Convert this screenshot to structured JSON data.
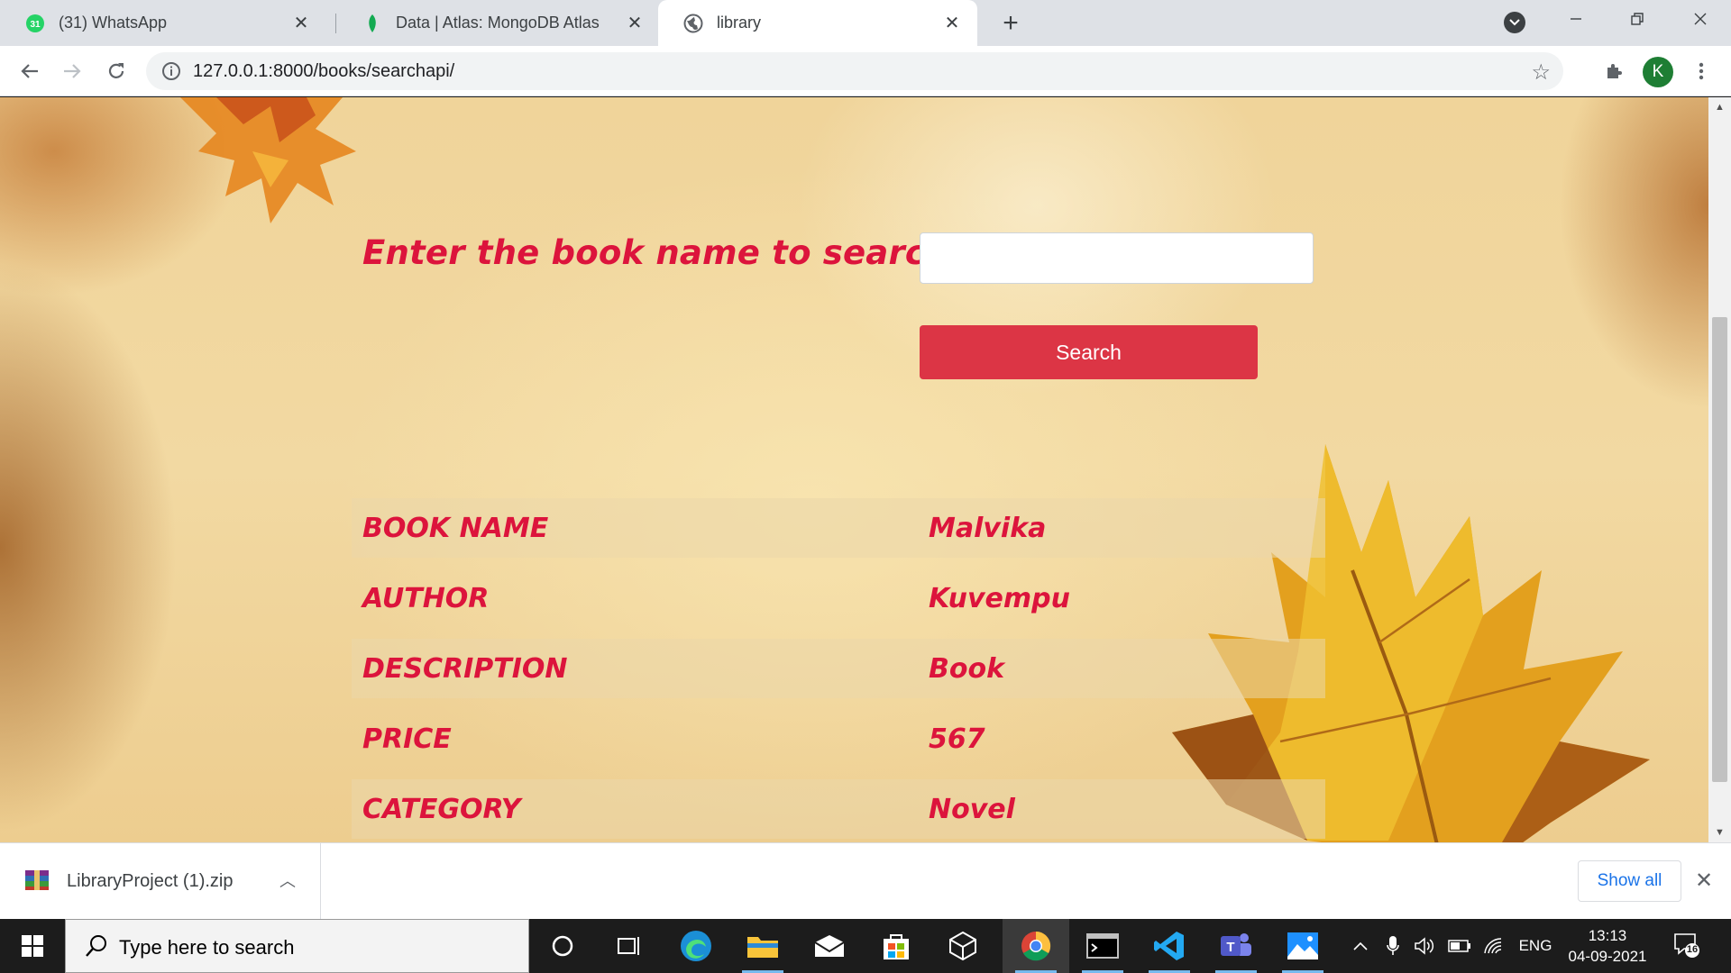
{
  "browser": {
    "tabs": [
      {
        "title": "(31) WhatsApp",
        "favicon_badge": "31",
        "icon": "whatsapp-icon",
        "active": false
      },
      {
        "title": "Data | Atlas: MongoDB Atlas",
        "icon": "mongodb-leaf-icon",
        "active": false
      },
      {
        "title": "library",
        "icon": "globe-icon",
        "active": true
      }
    ],
    "new_tab_label": "+",
    "url": "127.0.0.1:8000/books/searchapi/",
    "profile_initial": "K"
  },
  "page": {
    "search_label": "Enter the book name to search",
    "search_input": {
      "value": "",
      "placeholder": ""
    },
    "search_button": "Search",
    "result_rows": [
      {
        "key": "BOOK NAME",
        "value": "Malvika"
      },
      {
        "key": "AUTHOR",
        "value": "Kuvempu"
      },
      {
        "key": "DESCRIPTION",
        "value": "Book"
      },
      {
        "key": "PRICE",
        "value": "567"
      },
      {
        "key": "CATEGORY",
        "value": "Novel"
      }
    ],
    "colors": {
      "accent_text": "#dc143c",
      "button": "#dc3545"
    }
  },
  "download_shelf": {
    "file_name": "LibraryProject (1).zip",
    "show_all": "Show all"
  },
  "taskbar": {
    "search_placeholder": "Type here to search",
    "tray_lang": "ENG",
    "time": "13:13",
    "date": "04-09-2021",
    "notification_count": "16"
  }
}
